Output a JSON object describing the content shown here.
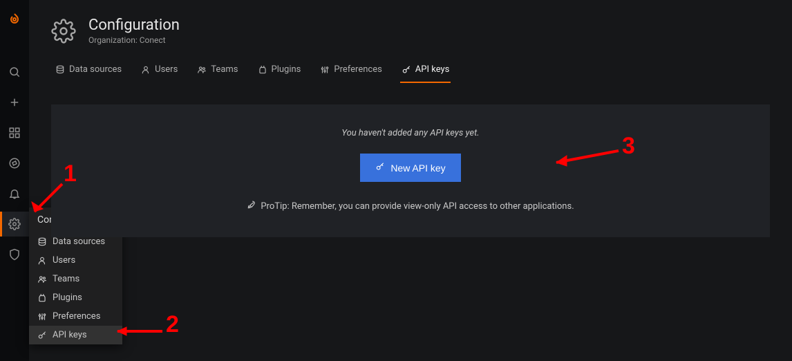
{
  "header": {
    "title": "Configuration",
    "subtitle": "Organization: Conect"
  },
  "tabs": [
    {
      "label": "Data sources"
    },
    {
      "label": "Users"
    },
    {
      "label": "Teams"
    },
    {
      "label": "Plugins"
    },
    {
      "label": "Preferences"
    },
    {
      "label": "API keys"
    }
  ],
  "panel": {
    "empty": "You haven't added any API keys yet.",
    "button": "New API key",
    "protip": "ProTip: Remember, you can provide view-only API access to other applications."
  },
  "flyout": {
    "title": "Configuration",
    "items": [
      {
        "label": "Data sources"
      },
      {
        "label": "Users"
      },
      {
        "label": "Teams"
      },
      {
        "label": "Plugins"
      },
      {
        "label": "Preferences"
      },
      {
        "label": "API keys"
      }
    ]
  },
  "annotations": {
    "n1": "1",
    "n2": "2",
    "n3": "3"
  }
}
